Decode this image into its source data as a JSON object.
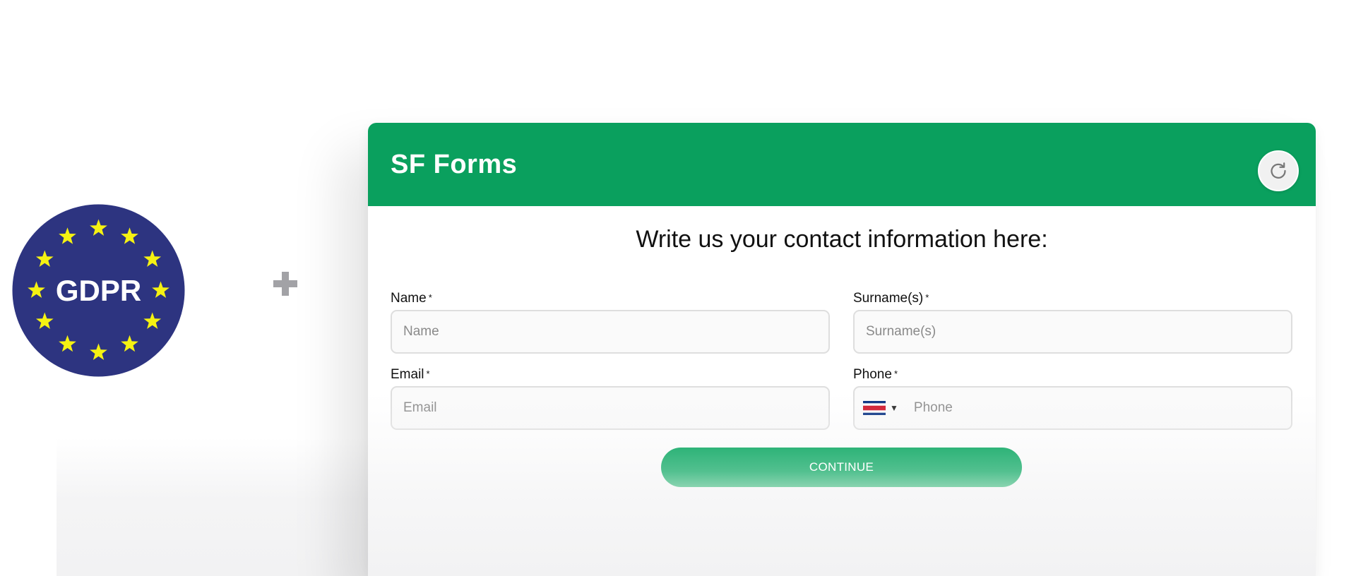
{
  "badge": {
    "text": "GDPR",
    "color": "#2d3480",
    "star_color": "#f5f212"
  },
  "plus_icon": "plus-icon",
  "header": {
    "app_title": "SF Forms",
    "bg_color": "#0aa05e",
    "refresh_icon": "refresh-icon"
  },
  "form": {
    "heading": "Write us your contact information here:",
    "required_marker": "*",
    "fields": {
      "name": {
        "label": "Name",
        "placeholder": "Name",
        "value": ""
      },
      "surname": {
        "label": "Surname(s)",
        "placeholder": "Surname(s)",
        "value": ""
      },
      "email": {
        "label": "Email",
        "placeholder": "Email",
        "value": ""
      },
      "phone": {
        "label": "Phone",
        "placeholder": "Phone",
        "value": "",
        "country_flag": "costa-rica-flag-icon",
        "caret": "▼"
      }
    },
    "continue_label": "CONTINUE"
  }
}
